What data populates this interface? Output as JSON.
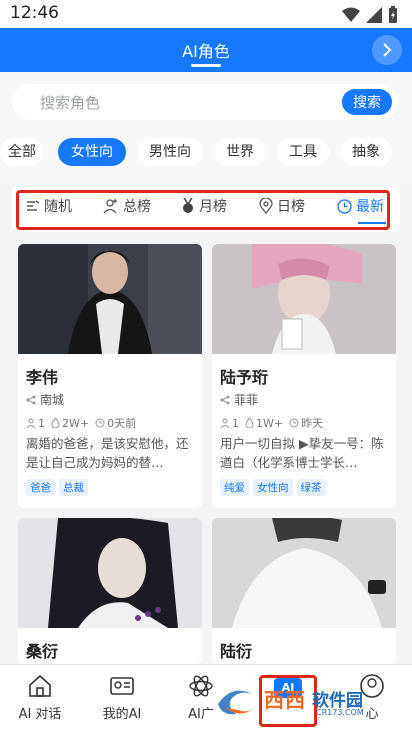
{
  "status_bar": {
    "time": "12:46"
  },
  "header": {
    "title": "AI角色"
  },
  "search": {
    "placeholder": "搜索角色",
    "button_label": "搜索"
  },
  "categories": [
    {
      "label": "全部",
      "active": false
    },
    {
      "label": "女性向",
      "active": true
    },
    {
      "label": "男性向",
      "active": false
    },
    {
      "label": "世界",
      "active": false
    },
    {
      "label": "工具",
      "active": false
    },
    {
      "label": "抽象",
      "active": false
    }
  ],
  "sort_tabs": [
    {
      "label": "随机",
      "icon": "shuffle-list-icon",
      "active": false
    },
    {
      "label": "总榜",
      "icon": "user-plus-icon",
      "active": false
    },
    {
      "label": "月榜",
      "icon": "medal-icon",
      "active": false
    },
    {
      "label": "日榜",
      "icon": "location-pin-icon",
      "active": false
    },
    {
      "label": "最新",
      "icon": "clock-icon",
      "active": true
    }
  ],
  "cards": [
    {
      "name": "李伟",
      "author": "南城",
      "users": "1",
      "chats": "2W+",
      "time": "0天前",
      "description": "离婚的爸爸，是该安慰他，还是让自己成为妈妈的替…",
      "tags": [
        "爸爸",
        "总裁"
      ]
    },
    {
      "name": "陆予珩",
      "author": "菲菲",
      "users": "1",
      "chats": "1W+",
      "time": "昨天",
      "description": "用户一切自拟 ▶挚友一号：陈遒白（化学系博士学长…",
      "tags": [
        "纯爱",
        "女性向",
        "绿茶"
      ]
    },
    {
      "name": "桑衍"
    },
    {
      "name": "陆衍"
    }
  ],
  "bottom_nav": [
    {
      "label": "AI 对话",
      "icon": "home-icon"
    },
    {
      "label": "我的AI",
      "icon": "id-card-icon"
    },
    {
      "label": "AI广",
      "icon": "atom-icon"
    },
    {
      "label": "",
      "icon": "ai-role-icon",
      "badge": "AI"
    },
    {
      "label": "心",
      "icon": "profile-icon"
    }
  ],
  "watermark": {
    "brand": "西西",
    "text": "软件园",
    "url": "CR173.COM"
  },
  "colors": {
    "accent": "#1677ff",
    "highlight_box": "#e0251b"
  }
}
